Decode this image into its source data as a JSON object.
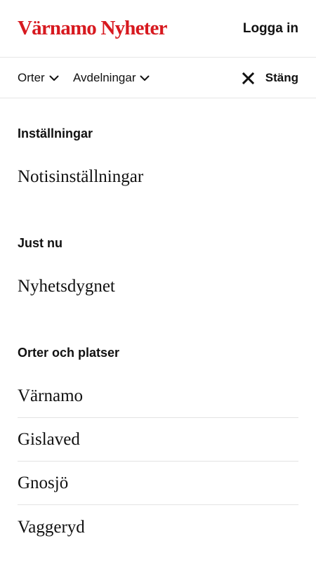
{
  "header": {
    "logo": "Värnamo Nyheter",
    "login_label": "Logga in"
  },
  "navbar": {
    "places_label": "Orter",
    "departments_label": "Avdelningar",
    "close_label": "Stäng"
  },
  "menu": {
    "settings": {
      "heading": "Inställningar",
      "items": [
        "Notisinställningar"
      ]
    },
    "right_now": {
      "heading": "Just nu",
      "items": [
        "Nyhetsdygnet"
      ]
    },
    "places": {
      "heading": "Orter och platser",
      "items": [
        "Värnamo",
        "Gislaved",
        "Gnosjö",
        "Vaggeryd"
      ]
    }
  },
  "colors": {
    "brand_red": "#d7191f",
    "text": "#111111",
    "divider": "#e3e3e3"
  }
}
